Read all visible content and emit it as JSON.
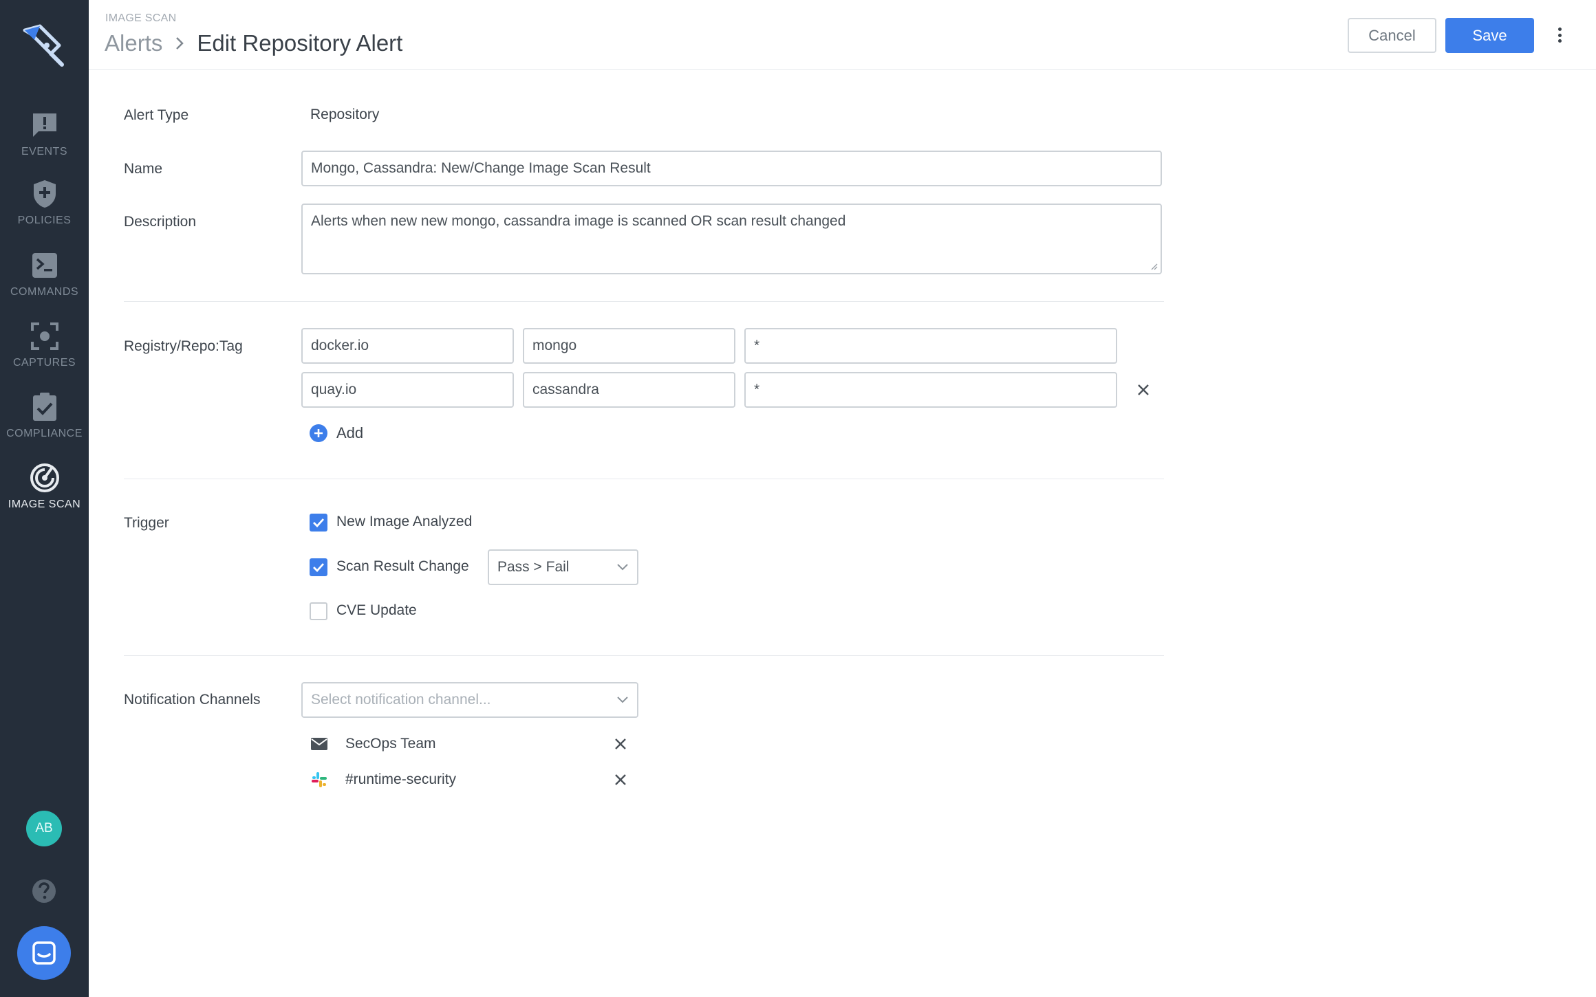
{
  "sidebar": {
    "items": [
      {
        "label": "EVENTS",
        "icon": "alert-bubble-icon"
      },
      {
        "label": "POLICIES",
        "icon": "shield-plus-icon"
      },
      {
        "label": "COMMANDS",
        "icon": "terminal-icon"
      },
      {
        "label": "CAPTURES",
        "icon": "capture-focus-icon"
      },
      {
        "label": "COMPLIANCE",
        "icon": "clipboard-check-icon"
      },
      {
        "label": "IMAGE SCAN",
        "icon": "radar-scan-icon",
        "active": true
      }
    ],
    "avatar_initials": "AB"
  },
  "header": {
    "section": "IMAGE SCAN",
    "parent": "Alerts",
    "title": "Edit Repository Alert",
    "cancel_label": "Cancel",
    "save_label": "Save"
  },
  "form": {
    "alert_type_label": "Alert Type",
    "alert_type_value": "Repository",
    "name_label": "Name",
    "name_value": "Mongo, Cassandra: New/Change Image Scan Result",
    "description_label": "Description",
    "description_value": "Alerts when new new mongo, cassandra image is scanned OR scan result changed",
    "registry_label": "Registry/Repo:Tag",
    "registry_rows": [
      {
        "registry": "docker.io",
        "repo": "mongo",
        "tag": "*"
      },
      {
        "registry": "quay.io",
        "repo": "cassandra",
        "tag": "*"
      }
    ],
    "add_label": "Add",
    "trigger_label": "Trigger",
    "triggers": [
      {
        "label": "New Image Analyzed",
        "checked": true
      },
      {
        "label": "Scan Result Change",
        "checked": true
      },
      {
        "label": "CVE Update",
        "checked": false
      }
    ],
    "scan_result_select": "Pass > Fail",
    "notification_label": "Notification Channels",
    "notification_placeholder": "Select notification channel...",
    "channels": [
      {
        "name": "SecOps Team",
        "icon": "email-icon"
      },
      {
        "name": "#runtime-security",
        "icon": "slack-icon"
      }
    ]
  },
  "colors": {
    "sidebar_bg": "#252e3a",
    "accent": "#3d7eea",
    "avatar": "#2bbcb4"
  }
}
